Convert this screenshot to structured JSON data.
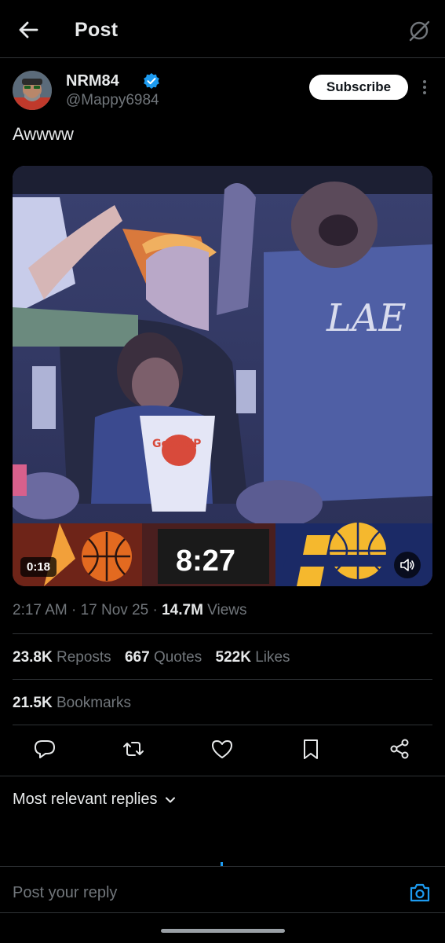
{
  "header": {
    "title": "Post"
  },
  "author": {
    "name": "NRM84",
    "handle": "@Mappy6984",
    "subscribe_label": "Subscribe"
  },
  "post": {
    "text": "Awwww",
    "video": {
      "duration": "0:18",
      "scoreboard_time": "8:27",
      "popcorn_text": "GoodUP"
    },
    "timestamp": "2:17 AM · 17 Nov 25 · ",
    "views_count": "14.7M",
    "views_label": " Views"
  },
  "stats": {
    "reposts_count": "23.8K",
    "reposts_label": "Reposts",
    "quotes_count": "667",
    "quotes_label": "Quotes",
    "likes_count": "522K",
    "likes_label": "Likes",
    "bookmarks_count": "21.5K",
    "bookmarks_label": "Bookmarks"
  },
  "replies": {
    "sort_label": "Most relevant replies"
  },
  "composer": {
    "placeholder": "Post your reply"
  },
  "colors": {
    "accent": "#1d9bf0",
    "background": "#000000",
    "secondary_text": "#71767b"
  },
  "icons": [
    "back-arrow-icon",
    "grok-icon",
    "verified-badge-icon",
    "more-icon",
    "mute-icon",
    "reply-icon",
    "repost-icon",
    "like-icon",
    "bookmark-icon",
    "share-icon",
    "chevron-down-icon",
    "camera-icon"
  ]
}
